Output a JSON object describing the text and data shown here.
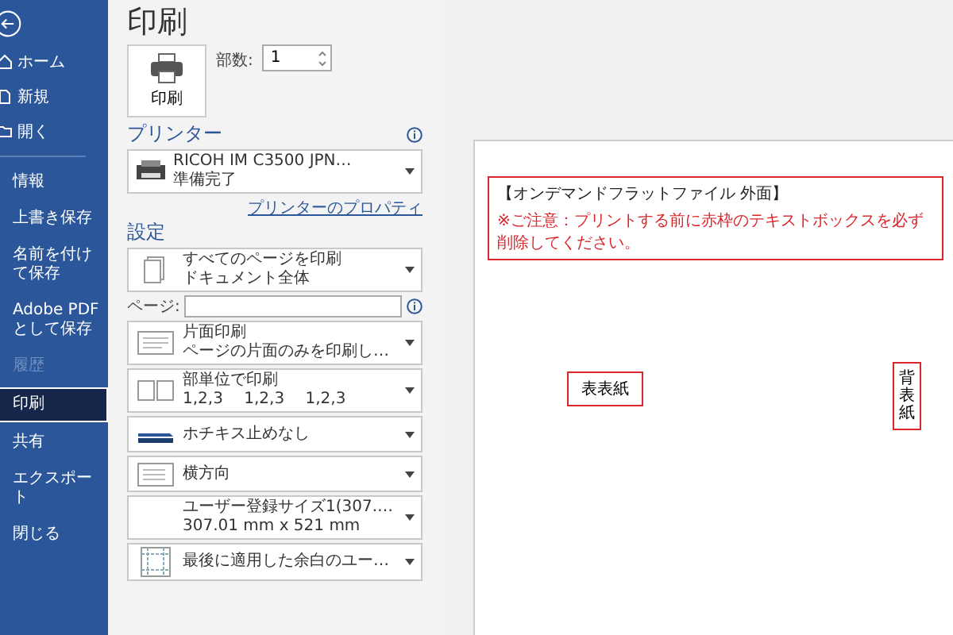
{
  "sidebar": {
    "top_items": [
      {
        "label": "ホーム"
      },
      {
        "label": "新規"
      },
      {
        "label": "開く"
      }
    ],
    "items": [
      {
        "label": "情報",
        "selected": false,
        "disabled": false
      },
      {
        "label": "上書き保存",
        "selected": false,
        "disabled": false
      },
      {
        "label": "名前を付けて保存",
        "selected": false,
        "disabled": false
      },
      {
        "label": "Adobe PDF として保存",
        "selected": false,
        "disabled": false
      },
      {
        "label": "履歴",
        "selected": false,
        "disabled": true
      },
      {
        "label": "印刷",
        "selected": true,
        "disabled": false
      },
      {
        "label": "共有",
        "selected": false,
        "disabled": false
      },
      {
        "label": "エクスポート",
        "selected": false,
        "disabled": false
      },
      {
        "label": "閉じる",
        "selected": false,
        "disabled": false
      }
    ]
  },
  "title": "印刷",
  "print_button": "印刷",
  "copies": {
    "label": "部数:",
    "value": "1"
  },
  "printer": {
    "heading": "プリンター",
    "name": "RICOH IM C3500 JPN…",
    "status": "準備完了",
    "properties_link": "プリンターのプロパティ"
  },
  "settings": {
    "heading": "設定",
    "items": [
      {
        "kind": "dropdown",
        "line1": "すべてのページを印刷",
        "line2": "ドキュメント全体"
      },
      {
        "kind": "pages",
        "label": "ページ:",
        "value": ""
      },
      {
        "kind": "dropdown",
        "line1": "片面印刷",
        "line2": "ページの片面のみを印刷し…"
      },
      {
        "kind": "dropdown",
        "line1": "部単位で印刷",
        "line2": "1,2,3　 1,2,3　 1,2,3"
      },
      {
        "kind": "dropdown",
        "line1": "ホチキス止めなし"
      },
      {
        "kind": "dropdown",
        "line1": "横方向"
      },
      {
        "kind": "dropdown",
        "line1": "ユーザー登録サイズ1(307.…",
        "line2": "307.01 mm x 521 mm"
      },
      {
        "kind": "dropdown",
        "line1": "最後に適用した余白のユー…"
      }
    ]
  },
  "preview": {
    "header_title": "【オンデマンドフラットファイル 外面】",
    "header_note": "※ご注意：プリントする前に赤枠のテキストボックスを必ず削除してください。",
    "front_label": "表表紙",
    "spine_label": "背表紙"
  }
}
